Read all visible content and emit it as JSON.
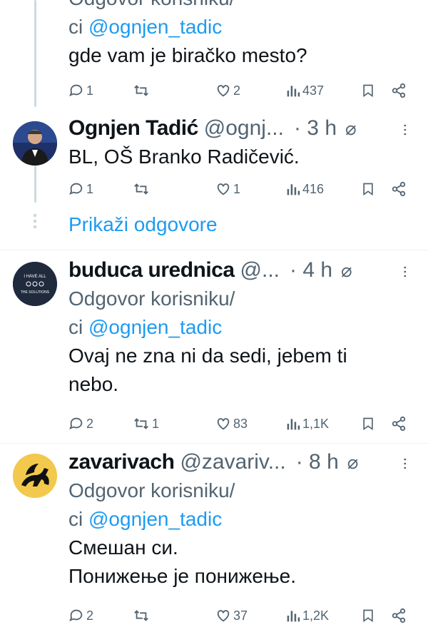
{
  "tweets": [
    {
      "reply_line1": "Odgovor korisniku/",
      "reply_prefix": "ci ",
      "reply_handle": "@ognjen_tadic",
      "text": [
        "gde vam je biračko mesto?"
      ],
      "replies": "1",
      "retweets": "",
      "likes": "2",
      "views": "437"
    },
    {
      "name": "Ognjen Tadić",
      "handle": "@ognj...",
      "time": "· 3 h",
      "text": [
        "BL, OŠ Branko Radičević."
      ],
      "replies": "1",
      "retweets": "",
      "likes": "1",
      "views": "416"
    },
    {
      "name": "buduca urednica",
      "handle": "@...",
      "time": "· 4 h",
      "avatar_text": [
        "I HAVE ALL",
        "THE SOLUTIONS"
      ],
      "reply_line1": "Odgovor korisniku/",
      "reply_prefix": "ci ",
      "reply_handle": "@ognjen_tadic",
      "text": [
        "Ovaj ne zna ni da sedi, jebem ti",
        "nebo."
      ],
      "replies": "2",
      "retweets": "1",
      "likes": "83",
      "views": "1,1K"
    },
    {
      "name": "zavarivach",
      "handle": "@zavariv...",
      "time": "· 8 h",
      "reply_line1": "Odgovor korisniku/",
      "reply_prefix": "ci ",
      "reply_handle": "@ognjen_tadic",
      "text": [
        "Смешан си.",
        "Понижење је понижење."
      ],
      "replies": "2",
      "retweets": "",
      "likes": "37",
      "views": "1,2K"
    }
  ],
  "show_replies": "Prikaži odgovore",
  "icons": [
    "reply-icon",
    "retweet-icon",
    "like-icon",
    "views-icon",
    "bookmark-icon",
    "share-icon",
    "grok-icon",
    "more-icon"
  ],
  "colors": {
    "link": "#1d9bf0",
    "muted": "#536471",
    "text": "#0f1419",
    "thread_line": "#cfd9de"
  }
}
